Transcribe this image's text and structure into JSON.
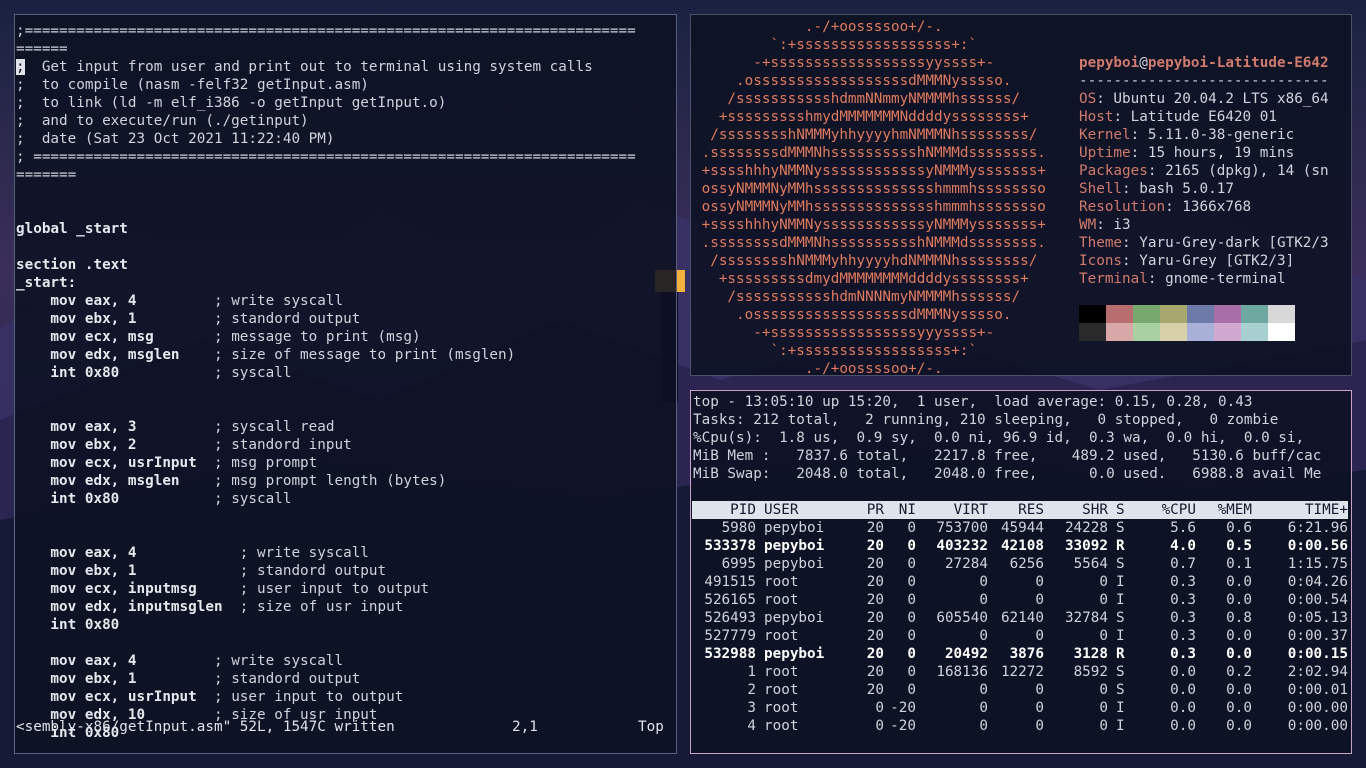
{
  "vim": {
    "lines": [
      ";=======================================================================",
      "======",
      ";  Get input from user and print out to terminal using system calls",
      ";  to compile (nasm -felf32 getInput.asm)",
      ";  to link (ld -m elf_i386 -o getInput getInput.o)",
      ";  and to execute/run (./getinput)",
      ";  date (Sat 23 Oct 2021 11:22:40 PM)",
      "; ======================================================================",
      "=======",
      "",
      "",
      "global _start",
      "",
      "section .text",
      "_start:",
      "    mov eax, 4         ; write syscall",
      "    mov ebx, 1         ; standord output",
      "    mov ecx, msg       ; message to print (msg)",
      "    mov edx, msglen    ; size of message to print (msglen)",
      "    int 0x80           ; syscall",
      "",
      "",
      "    mov eax, 3         ; syscall read",
      "    mov ebx, 2         ; standord input",
      "    mov ecx, usrInput  ; msg prompt",
      "    mov edx, msglen    ; msg prompt length (bytes)",
      "    int 0x80           ; syscall",
      "",
      "",
      "    mov eax, 4            ; write syscall",
      "    mov ebx, 1            ; standord output",
      "    mov ecx, inputmsg     ; user input to output",
      "    mov edx, inputmsglen  ; size of usr input",
      "    int 0x80",
      "",
      "    mov eax, 4         ; write syscall",
      "    mov ebx, 1         ; standord output",
      "    mov ecx, usrInput  ; user input to output",
      "    mov edx, 10        ; size of usr input",
      "    int 0x80"
    ],
    "status_file": "<sembly-x86/getInput.asm\" 52L, 1547C written",
    "status_pos": "2,1",
    "status_scroll": "Top"
  },
  "neofetch": {
    "logo": [
      "             .-/+oossssoo+/-.",
      "         `:+ssssssssssssssssss+:`",
      "       -+ssssssssssssssssssyyssss+-",
      "     .ossssssssssssssssssdMMMNysssso.",
      "    /ssssssssssshdmmNNmmyNMMMMhssssss/",
      "   +ssssssssshmydMMMMMMMNddddyssssssss+",
      "  /sssssssshNMMMyhhyyyyhmNMMMNhssssssss/",
      " .ssssssssdMMMNhsssssssssshNMMMdssssssss.",
      " +sssshhhyNMMNyssssssssssssyNMMMysssssss+",
      " ossyNMMMNyMMhsssssssssssssshmmmhssssssso",
      " ossyNMMMNyMMhsssssssssssssshmmmhssssssso",
      " +sssshhhyNMMNyssssssssssssyNMMMysssssss+",
      " .ssssssssdMMMNhsssssssssshNMMMdssssssss.",
      "  /sssssssshNMMMyhhyyyyhdNMMMNhssssssss/",
      "   +sssssssssdmydMMMMMMMMddddyssssssss+",
      "    /ssssssssssshdmNNNNmyNMMMMhssssss/",
      "     .ossssssssssssssssssdMMMNysssso.",
      "       -+sssssssssssssssssyyyssss+-",
      "         `:+ssssssssssssssssss+:`",
      "             .-/+oossssoo+/-."
    ],
    "user": "pepyboi",
    "host": "pepyboi-Latitude-E642",
    "separator": "-----------------------------",
    "fields": [
      {
        "key": "OS",
        "value": "Ubuntu 20.04.2 LTS x86_64"
      },
      {
        "key": "Host",
        "value": "Latitude E6420 01"
      },
      {
        "key": "Kernel",
        "value": "5.11.0-38-generic"
      },
      {
        "key": "Uptime",
        "value": "15 hours, 19 mins"
      },
      {
        "key": "Packages",
        "value": "2165 (dpkg), 14 (sn"
      },
      {
        "key": "Shell",
        "value": "bash 5.0.17"
      },
      {
        "key": "Resolution",
        "value": "1366x768"
      },
      {
        "key": "WM",
        "value": "i3"
      },
      {
        "key": "Theme",
        "value": "Yaru-Grey-dark [GTK2/3"
      },
      {
        "key": "Icons",
        "value": "Yaru-Grey [GTK2/3]"
      },
      {
        "key": "Terminal",
        "value": "gnome-terminal"
      }
    ],
    "palette_row1": [
      "#000000",
      "#b86e6e",
      "#77a86e",
      "#a8a86e",
      "#6e7aa8",
      "#a86ea8",
      "#6ea8a0",
      "#d8d8d8"
    ],
    "palette_row2": [
      "#2a2a2a",
      "#d8a8a8",
      "#a8d0a0",
      "#d8d0a8",
      "#a8b0d8",
      "#d0a8d0",
      "#a8d0d0",
      "#ffffff"
    ]
  },
  "top": {
    "header": [
      "top - 13:05:10 up 15:20,  1 user,  load average: 0.15, 0.28, 0.43",
      "Tasks: 212 total,   2 running, 210 sleeping,   0 stopped,   0 zombie",
      "%Cpu(s):  1.8 us,  0.9 sy,  0.0 ni, 96.9 id,  0.3 wa,  0.0 hi,  0.0 si,",
      "MiB Mem :   7837.6 total,   2217.8 free,    489.2 used,   5130.6 buff/cac",
      "MiB Swap:   2048.0 total,   2048.0 free,      0.0 used.   6988.8 avail Me"
    ],
    "columns": [
      "PID",
      "USER",
      "PR",
      "NI",
      "VIRT",
      "RES",
      "SHR",
      "S",
      "%CPU",
      "%MEM",
      "TIME+"
    ],
    "rows": [
      {
        "bold": false,
        "cells": [
          "5980",
          "pepyboi",
          "20",
          "0",
          "753700",
          "45944",
          "24228",
          "S",
          "5.6",
          "0.6",
          "6:21.96"
        ]
      },
      {
        "bold": true,
        "cells": [
          "533378",
          "pepyboi",
          "20",
          "0",
          "403232",
          "42108",
          "33092",
          "R",
          "4.0",
          "0.5",
          "0:00.56"
        ]
      },
      {
        "bold": false,
        "cells": [
          "6995",
          "pepyboi",
          "20",
          "0",
          "27284",
          "6256",
          "5564",
          "S",
          "0.7",
          "0.1",
          "1:15.75"
        ]
      },
      {
        "bold": false,
        "cells": [
          "491515",
          "root",
          "20",
          "0",
          "0",
          "0",
          "0",
          "I",
          "0.3",
          "0.0",
          "0:04.26"
        ]
      },
      {
        "bold": false,
        "cells": [
          "526165",
          "root",
          "20",
          "0",
          "0",
          "0",
          "0",
          "I",
          "0.3",
          "0.0",
          "0:00.54"
        ]
      },
      {
        "bold": false,
        "cells": [
          "526493",
          "pepyboi",
          "20",
          "0",
          "605540",
          "62140",
          "32784",
          "S",
          "0.3",
          "0.8",
          "0:05.13"
        ]
      },
      {
        "bold": false,
        "cells": [
          "527779",
          "root",
          "20",
          "0",
          "0",
          "0",
          "0",
          "I",
          "0.3",
          "0.0",
          "0:00.37"
        ]
      },
      {
        "bold": true,
        "cells": [
          "532988",
          "pepyboi",
          "20",
          "0",
          "20492",
          "3876",
          "3128",
          "R",
          "0.3",
          "0.0",
          "0:00.15"
        ]
      },
      {
        "bold": false,
        "cells": [
          "1",
          "root",
          "20",
          "0",
          "168136",
          "12272",
          "8592",
          "S",
          "0.0",
          "0.2",
          "2:02.94"
        ]
      },
      {
        "bold": false,
        "cells": [
          "2",
          "root",
          "20",
          "0",
          "0",
          "0",
          "0",
          "S",
          "0.0",
          "0.0",
          "0:00.01"
        ]
      },
      {
        "bold": false,
        "cells": [
          "3",
          "root",
          "0",
          "-20",
          "0",
          "0",
          "0",
          "I",
          "0.0",
          "0.0",
          "0:00.00"
        ]
      },
      {
        "bold": false,
        "cells": [
          "4",
          "root",
          "0",
          "-20",
          "0",
          "0",
          "0",
          "I",
          "0.0",
          "0.0",
          "0:00.00"
        ]
      }
    ]
  }
}
